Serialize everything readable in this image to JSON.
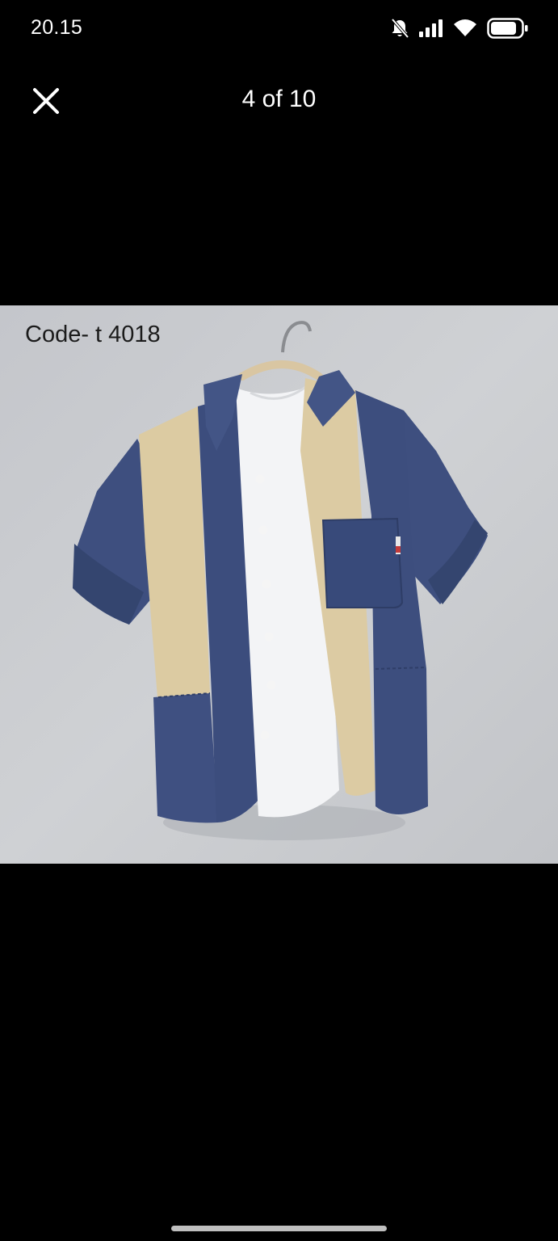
{
  "status_bar": {
    "time": "20.15",
    "icons": [
      "bell-muted-icon",
      "signal-icon",
      "wifi-icon",
      "battery-icon"
    ]
  },
  "viewer": {
    "close_icon": "close-icon",
    "counter": "4 of 10"
  },
  "image": {
    "caption_text": "Code- t 4018",
    "subject": "short-sleeve shirt in navy and khaki panels with white tee on hanger"
  },
  "colors": {
    "background": "#000000",
    "navy": "#3d4f80",
    "khaki": "#dccba3",
    "backdrop": "#c9cbcf"
  }
}
